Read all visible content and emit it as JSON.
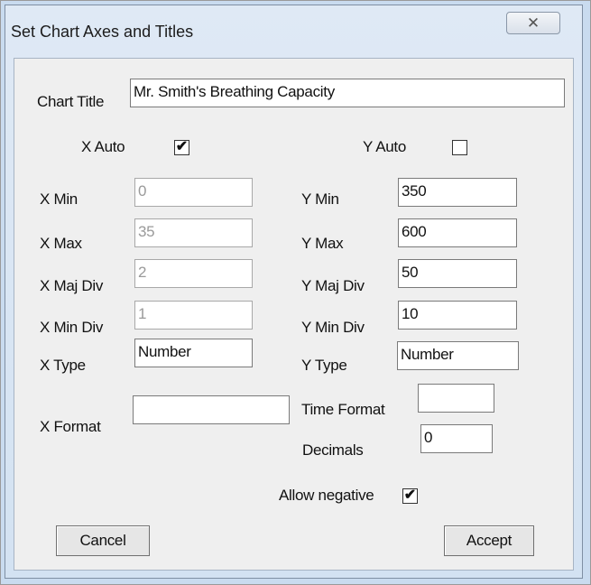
{
  "window": {
    "title": "Set Chart Axes and Titles",
    "close_glyph": "✕"
  },
  "chart_title": {
    "label": "Chart Title",
    "value": "Mr. Smith's Breathing Capacity"
  },
  "x_axis": {
    "auto_label": "X Auto",
    "auto_checked": true,
    "min_label": "X Min",
    "min_value": "0",
    "max_label": "X Max",
    "max_value": "35",
    "maj_div_label": "X Maj Div",
    "maj_div_value": "2",
    "min_div_label": "X Min Div",
    "min_div_value": "1",
    "type_label": "X Type",
    "type_value": "Number",
    "format_label": "X Format",
    "format_value": ""
  },
  "y_axis": {
    "auto_label": "Y Auto",
    "auto_checked": false,
    "min_label": "Y Min",
    "min_value": "350",
    "max_label": "Y Max",
    "max_value": "600",
    "maj_div_label": "Y Maj Div",
    "maj_div_value": "50",
    "min_div_label": "Y Min Div",
    "min_div_value": "10",
    "type_label": "Y Type",
    "type_value": "Number",
    "time_format_label": "Time Format",
    "time_format_value": "",
    "decimals_label": "Decimals",
    "decimals_value": "0"
  },
  "allow_negative": {
    "label": "Allow negative",
    "checked": true
  },
  "buttons": {
    "cancel": "Cancel",
    "accept": "Accept"
  },
  "check_mark": "✔"
}
